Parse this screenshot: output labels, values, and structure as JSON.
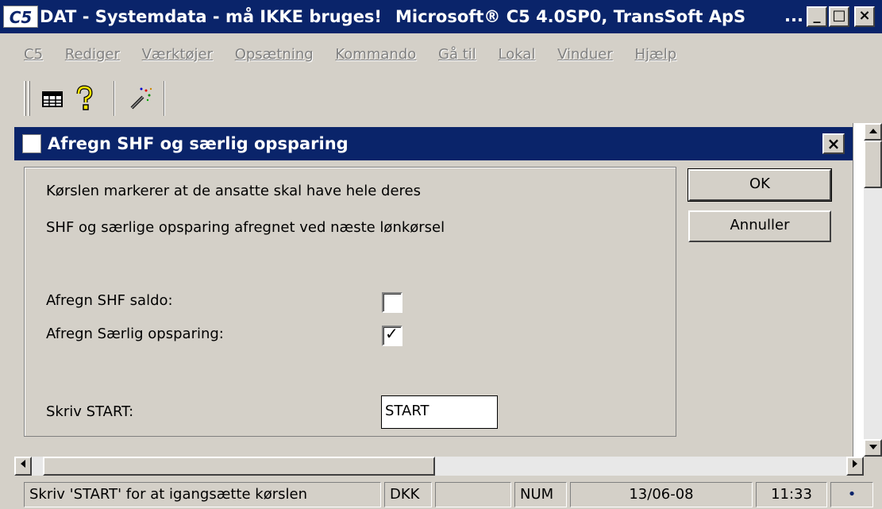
{
  "window": {
    "app_logo": "C5",
    "title_left": "DAT - Systemdata - må IKKE bruges!",
    "title_right": "Microsoft® C5 4.0SP0, TransSoft ApS",
    "title_dots": "...",
    "minimize": "_",
    "maximize": "□",
    "close": "×"
  },
  "menu": {
    "items": [
      "C5",
      "Rediger",
      "Værktøjer",
      "Opsætning",
      "Kommando",
      "Gå til",
      "Lokal",
      "Vinduer",
      "Hjælp"
    ]
  },
  "toolbar": {
    "icons": [
      "table-icon",
      "help-question-icon",
      "wizard-wand-icon"
    ]
  },
  "dialog": {
    "title": "Afregn SHF og særlig opsparing",
    "close": "×",
    "line1": "Kørslen markerer at de ansatte skal have hele deres",
    "line2": "SHF og særlige opsparing afregnet ved næste lønkørsel",
    "shf_label": "Afregn SHF saldo:",
    "shf_checked": false,
    "saerlig_label": "Afregn Særlig opsparing:",
    "saerlig_checked": true,
    "start_label": "Skriv START:",
    "start_value": "START",
    "ok": "OK",
    "cancel": "Annuller"
  },
  "status": {
    "message": "Skriv 'START' for at igangsætte kørslen",
    "currency": "DKK",
    "blank": "",
    "num": "NUM",
    "date": "13/06-08",
    "time": "11:33",
    "indicator": "•"
  }
}
